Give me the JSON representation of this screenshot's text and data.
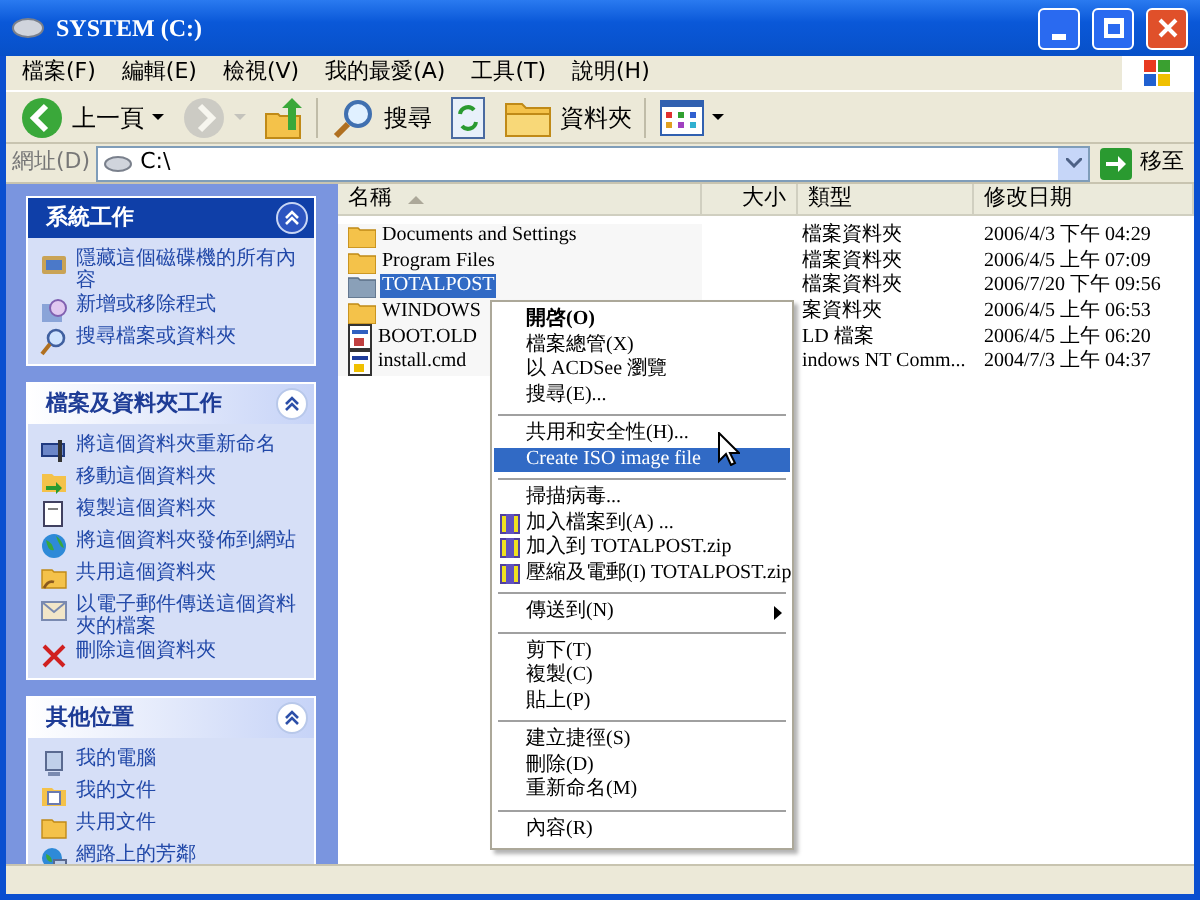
{
  "window": {
    "title": "SYSTEM (C:)"
  },
  "menu_bar": [
    "檔案(F)",
    "編輯(E)",
    "檢視(V)",
    "我的最愛(A)",
    "工具(T)",
    "說明(H)"
  ],
  "toolbar": [
    {
      "kind": "back",
      "label": "上一頁",
      "disabled": false
    },
    {
      "kind": "forward",
      "disabled": true
    },
    {
      "kind": "up",
      "disabled": false
    },
    {
      "kind": "search",
      "label": "搜尋",
      "disabled": false
    },
    {
      "kind": "sync",
      "disabled": false
    },
    {
      "kind": "folders",
      "label": "資料夾",
      "disabled": false
    },
    {
      "kind": "views",
      "disabled": false
    }
  ],
  "address": {
    "label": "網址(D)",
    "value": "C:\\",
    "go": "移至"
  },
  "task_panes": [
    {
      "title": "系統工作",
      "kind": "dark",
      "items": [
        {
          "label": "隱藏這個磁碟機的所有內容"
        },
        {
          "label": "新增或移除程式"
        },
        {
          "label": "搜尋檔案或資料夾"
        }
      ]
    },
    {
      "title": "檔案及資料夾工作",
      "kind": "light",
      "items": [
        {
          "label": "將這個資料夾重新命名"
        },
        {
          "label": "移動這個資料夾"
        },
        {
          "label": "複製這個資料夾"
        },
        {
          "label": "將這個資料夾發佈到網站"
        },
        {
          "label": "共用這個資料夾"
        },
        {
          "label": "以電子郵件傳送這個資料夾的檔案"
        },
        {
          "label": "刪除這個資料夾"
        }
      ]
    },
    {
      "title": "其他位置",
      "kind": "light",
      "items": [
        {
          "label": "我的電腦"
        },
        {
          "label": "我的文件"
        },
        {
          "label": "共用文件"
        },
        {
          "label": "網路上的芳鄰"
        }
      ]
    }
  ],
  "columns": [
    "名稱",
    "大小",
    "類型",
    "修改日期"
  ],
  "files": [
    {
      "name": "Documents and Settings",
      "kind": "folder",
      "type": "檔案資料夾",
      "modified": "2006/4/3 下午 04:29",
      "selected": false
    },
    {
      "name": "Program Files",
      "kind": "folder",
      "type": "檔案資料夾",
      "modified": "2006/4/5 上午 07:09",
      "selected": false
    },
    {
      "name": "TOTALPOST",
      "kind": "folder",
      "type": "檔案資料夾",
      "modified": "2006/7/20 下午 09:56",
      "selected": true
    },
    {
      "name": "WINDOWS",
      "kind": "folder",
      "type": "案資料夾",
      "modified": "2006/4/5 上午 06:53",
      "selected": false
    },
    {
      "name": "BOOT.OLD",
      "kind": "file",
      "type": "LD 檔案",
      "modified": "2006/4/5 上午 06:20",
      "selected": false
    },
    {
      "name": "install.cmd",
      "kind": "script",
      "type": "indows NT Comm...",
      "modified": "2004/7/3 上午 04:37",
      "selected": false
    }
  ],
  "context_menu": [
    {
      "kind": "item",
      "label": "開啓(O)",
      "bold": true,
      "selected": false
    },
    {
      "kind": "item",
      "label": "檔案總管(X)",
      "selected": false
    },
    {
      "kind": "item",
      "label": "以 ACDSee 瀏覽",
      "selected": false
    },
    {
      "kind": "item",
      "label": "搜尋(E)...",
      "selected": false
    },
    {
      "kind": "separator"
    },
    {
      "kind": "item",
      "label": "共用和安全性(H)...",
      "selected": false
    },
    {
      "kind": "item",
      "label": "Create ISO image file",
      "selected": true
    },
    {
      "kind": "separator"
    },
    {
      "kind": "item",
      "label": "掃描病毒...",
      "selected": false
    },
    {
      "kind": "archive",
      "label": "加入檔案到(A) ...",
      "selected": false
    },
    {
      "kind": "archive",
      "label": "加入到 TOTALPOST.zip",
      "selected": false
    },
    {
      "kind": "archive",
      "label": "壓縮及電郵(I) TOTALPOST.zip",
      "selected": false
    },
    {
      "kind": "separator"
    },
    {
      "kind": "submenu",
      "label": "傳送到(N)",
      "selected": false
    },
    {
      "kind": "separator"
    },
    {
      "kind": "item",
      "label": "剪下(T)",
      "selected": false
    },
    {
      "kind": "item",
      "label": "複製(C)",
      "selected": false
    },
    {
      "kind": "item",
      "label": "貼上(P)",
      "selected": false
    },
    {
      "kind": "separator"
    },
    {
      "kind": "item",
      "label": "建立捷徑(S)",
      "selected": false
    },
    {
      "kind": "item",
      "label": "刪除(D)",
      "selected": false
    },
    {
      "kind": "item",
      "label": "重新命名(M)",
      "selected": false
    },
    {
      "kind": "separator"
    },
    {
      "kind": "item",
      "label": "內容(R)",
      "selected": false
    }
  ]
}
